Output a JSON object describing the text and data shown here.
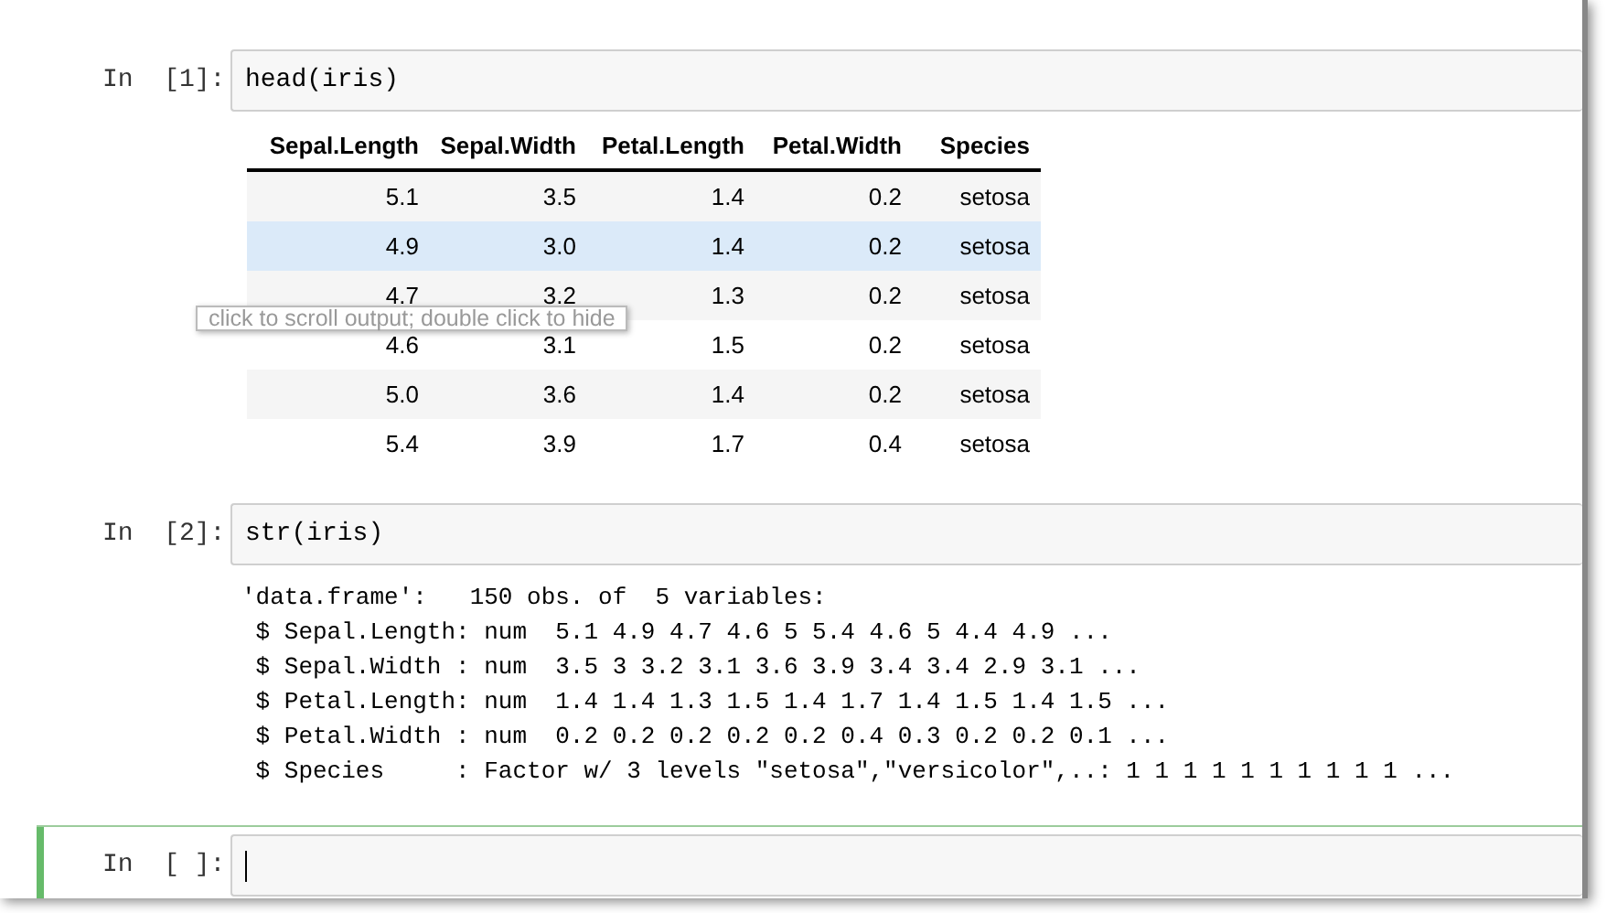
{
  "cells": [
    {
      "prompt": "In  [1]:",
      "code": "head(iris)",
      "selected": false,
      "output": {
        "kind": "table",
        "columns": [
          "Sepal.Length",
          "Sepal.Width",
          "Petal.Length",
          "Petal.Width",
          "Species"
        ],
        "rows": [
          {
            "cells": [
              "5.1",
              "3.5",
              "1.4",
              "0.2",
              "setosa"
            ],
            "hovered": false
          },
          {
            "cells": [
              "4.9",
              "3.0",
              "1.4",
              "0.2",
              "setosa"
            ],
            "hovered": true
          },
          {
            "cells": [
              "4.7",
              "3.2",
              "1.3",
              "0.2",
              "setosa"
            ],
            "hovered": false
          },
          {
            "cells": [
              "4.6",
              "3.1",
              "1.5",
              "0.2",
              "setosa"
            ],
            "hovered": false
          },
          {
            "cells": [
              "5.0",
              "3.6",
              "1.4",
              "0.2",
              "setosa"
            ],
            "hovered": false
          },
          {
            "cells": [
              "5.4",
              "3.9",
              "1.7",
              "0.4",
              "setosa"
            ],
            "hovered": false
          }
        ]
      }
    },
    {
      "prompt": "In  [2]:",
      "code": "str(iris)",
      "selected": false,
      "output": {
        "kind": "text",
        "lines": [
          "'data.frame':   150 obs. of  5 variables:",
          " $ Sepal.Length: num  5.1 4.9 4.7 4.6 5 5.4 4.6 5 4.4 4.9 ...",
          " $ Sepal.Width : num  3.5 3 3.2 3.1 3.6 3.9 3.4 3.4 2.9 3.1 ...",
          " $ Petal.Length: num  1.4 1.4 1.3 1.5 1.4 1.7 1.4 1.5 1.4 1.5 ...",
          " $ Petal.Width : num  0.2 0.2 0.2 0.2 0.2 0.4 0.3 0.2 0.2 0.1 ...",
          " $ Species     : Factor w/ 3 levels \"setosa\",\"versicolor\",..: 1 1 1 1 1 1 1 1 1 1 ..."
        ]
      }
    },
    {
      "prompt": "In  [ ]:",
      "selected": true
    }
  ],
  "tooltip": "click to scroll output; double click to hide"
}
